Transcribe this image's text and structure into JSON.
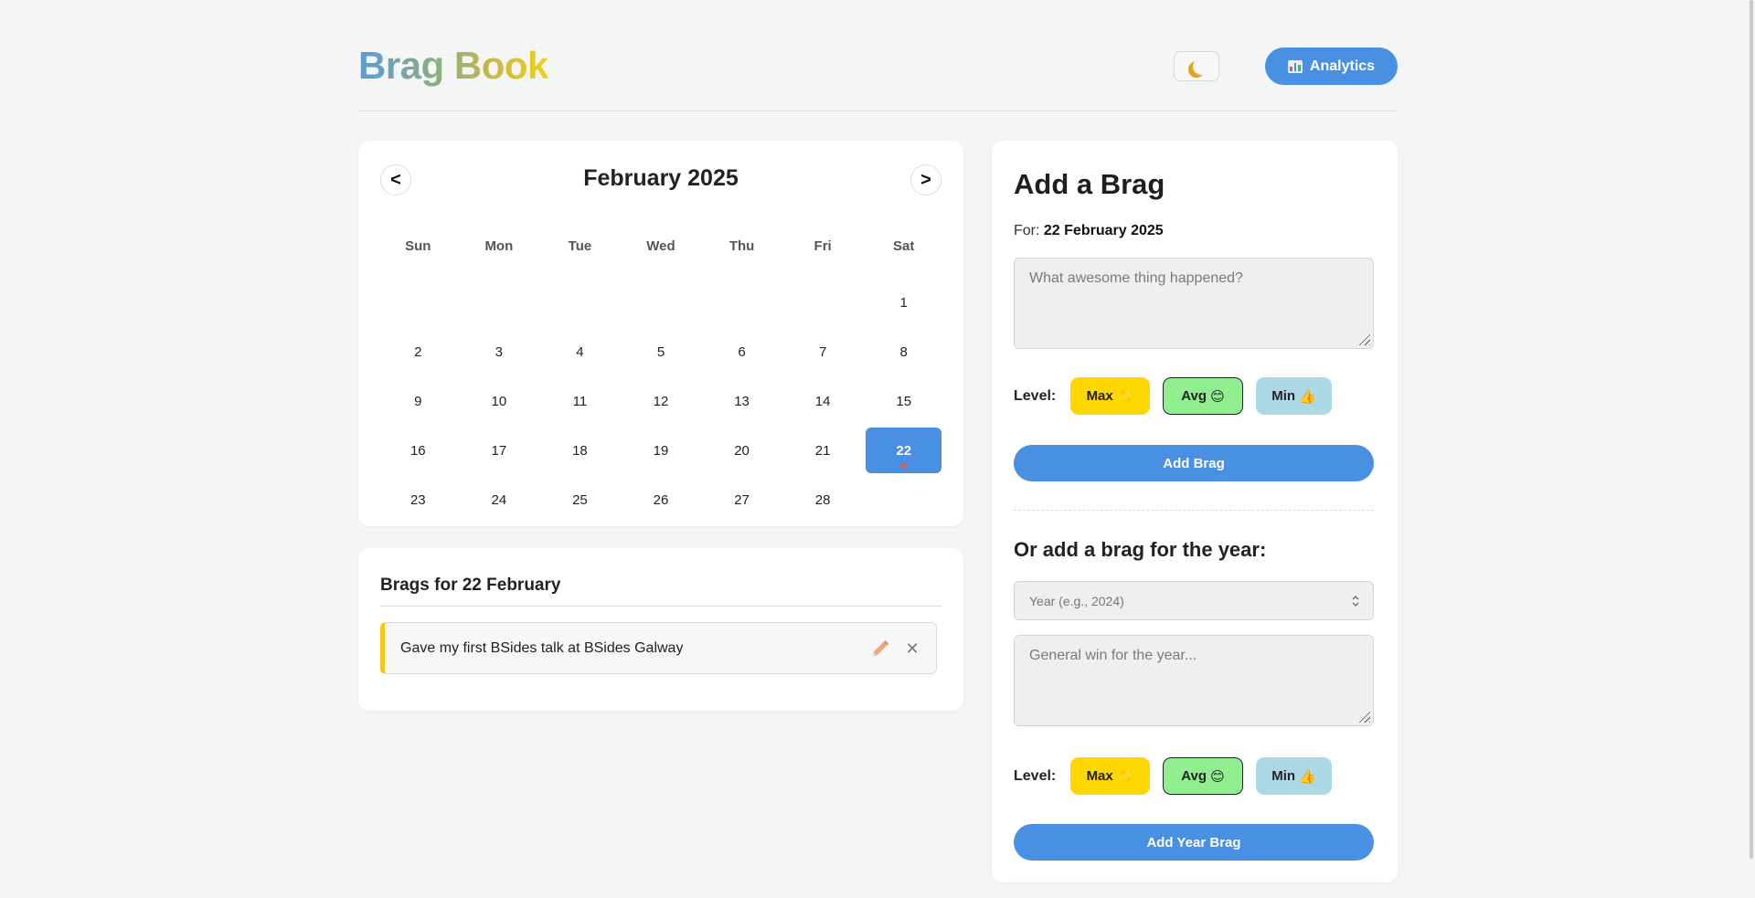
{
  "header": {
    "title": "Brag Book",
    "analytics_label": "Analytics",
    "theme_icon": "moon-icon",
    "analytics_icon": "bar-chart-icon"
  },
  "calendar": {
    "month_label": "February 2025",
    "prev_label": "<",
    "next_label": ">",
    "weekdays": [
      "Sun",
      "Mon",
      "Tue",
      "Wed",
      "Thu",
      "Fri",
      "Sat"
    ],
    "leading_blanks": 6,
    "days": [
      "1",
      "2",
      "3",
      "4",
      "5",
      "6",
      "7",
      "8",
      "9",
      "10",
      "11",
      "12",
      "13",
      "14",
      "15",
      "16",
      "17",
      "18",
      "19",
      "20",
      "21",
      "22",
      "23",
      "24",
      "25",
      "26",
      "27",
      "28"
    ],
    "selected_day": "22",
    "days_with_brags": [
      "22"
    ]
  },
  "brags_panel": {
    "title": "Brags for 22 February",
    "items": [
      {
        "text": "Gave my first BSides talk at BSides Galway",
        "level_color": "#f5c518"
      }
    ]
  },
  "add_brag": {
    "title": "Add a Brag",
    "for_prefix": "For:",
    "for_date": "22 February 2025",
    "textarea_placeholder": "What awesome thing happened?",
    "level_label": "Level:",
    "levels": [
      {
        "label": "Max",
        "emoji": "✨",
        "color": "#ffd700"
      },
      {
        "label": "Avg",
        "emoji": "😊",
        "color": "#90ee90"
      },
      {
        "label": "Min",
        "emoji": "👍",
        "color": "#add8e6"
      }
    ],
    "selected_level": "Avg",
    "submit_label": "Add Brag"
  },
  "year_brag": {
    "title": "Or add a brag for the year:",
    "year_placeholder": "Year (e.g., 2024)",
    "textarea_placeholder": "General win for the year...",
    "level_label": "Level:",
    "submit_label": "Add Year Brag"
  },
  "colors": {
    "accent": "#4a90e2",
    "background": "#f4f6f5",
    "selected_day": "#4a90e2",
    "brag_dot": "#e55a4a"
  }
}
